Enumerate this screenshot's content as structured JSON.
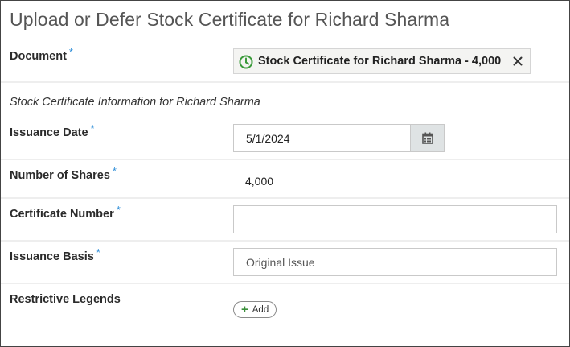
{
  "dialog": {
    "title": "Upload or Defer Stock Certificate for Richard Sharma"
  },
  "document": {
    "label": "Document",
    "required_mark": "*",
    "file_name": "Stock Certificate for Richard Sharma - 4,000",
    "status_icon": "clock-icon",
    "remove_icon": "close-icon"
  },
  "section": {
    "caption": "Stock Certificate Information for Richard Sharma"
  },
  "fields": {
    "issuance_date": {
      "label": "Issuance Date",
      "required_mark": "*",
      "value": "5/1/2024",
      "picker_icon": "calendar-icon"
    },
    "number_of_shares": {
      "label": "Number of Shares",
      "required_mark": "*",
      "value": "4,000"
    },
    "certificate_number": {
      "label": "Certificate Number",
      "required_mark": "*",
      "value": ""
    },
    "issuance_basis": {
      "label": "Issuance Basis",
      "required_mark": "*",
      "value": "Original Issue"
    },
    "restrictive_legends": {
      "label": "Restrictive Legends",
      "add_label": "Add",
      "add_icon": "plus-icon"
    }
  },
  "colors": {
    "required": "#2f8ed8",
    "status_icon": "#3a9a3a",
    "calendar_button_bg": "#dfe3e4"
  }
}
